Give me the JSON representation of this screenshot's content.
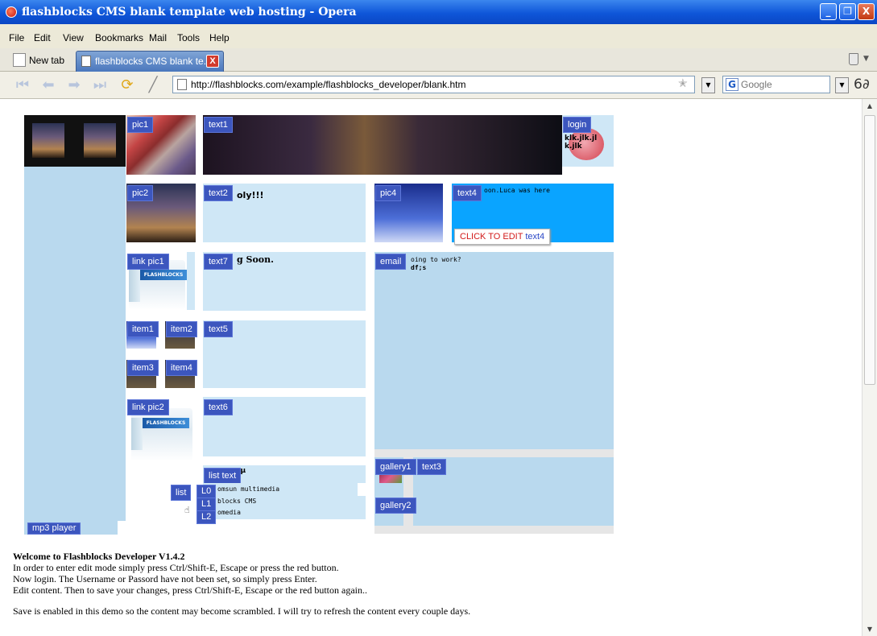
{
  "window": {
    "title": "flashblocks CMS blank template web hosting - Opera",
    "minimize": "_",
    "maximize": "❐",
    "close": "X"
  },
  "menu": [
    "File",
    "Edit",
    "View",
    "Bookmarks",
    "Mail",
    "Tools",
    "Help"
  ],
  "tabs": {
    "new_tab": "New tab",
    "active": "flashblocks CMS blank te...",
    "close": "X"
  },
  "address": {
    "url": "http://flashblocks.com/example/flashblocks_developer/blank.htm",
    "search_placeholder": "Google",
    "search_engine_letter": "G"
  },
  "page": {
    "buttons": {
      "pic1": "pic1",
      "text1": "text1",
      "login": "login",
      "pic2": "pic2",
      "text2": "text2",
      "pic4": "pic4",
      "text4": "text4",
      "link_pic1": "link pic1",
      "text7": "text7",
      "email": "email",
      "item1": "item1",
      "item2": "item2",
      "text5": "text5",
      "item3": "item3",
      "item4": "item4",
      "link_pic2": "link pic2",
      "text6": "text6",
      "list_text": "list text",
      "list": "list",
      "l0": "L0",
      "l1": "L1",
      "l2": "L2",
      "gallery1": "gallery1",
      "text3": "text3",
      "gallery2": "gallery2",
      "mp3_player": "mp3 player"
    },
    "content": {
      "login_text": "klk.jlk.jl k.jlk",
      "text2_body": "oly!!!",
      "text4_body": "oon.Luca was here",
      "text7_body": "g Soon.",
      "email_body_1": "oing to work?",
      "email_body_2": "df;s",
      "list_text_body": "ı.µ",
      "list_items": [
        "omsun multimedia",
        "blocks CMS",
        "omedia"
      ],
      "flash_logo": "FLASHBLOCKS"
    },
    "tooltip": {
      "action": "CLICK TO EDIT",
      "target": "text4"
    }
  },
  "welcome": {
    "heading": "Welcome to Flashblocks Developer V1.4.2",
    "line1": "In order to enter edit mode simply press Ctrl/Shift-E, Escape or press the red button.",
    "line2": "Now login. The Username or Passord have not been set, so simply press Enter.",
    "line3": "Edit content. Then to save your changes, press Ctrl/Shift-E, Escape or the red button again..",
    "line4": "Save is enabled in this demo so the content may become scrambled. I will try to refresh the content every couple days."
  }
}
